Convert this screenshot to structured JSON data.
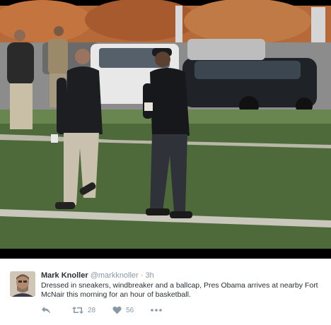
{
  "photo": {
    "description_icon": "photo-image"
  },
  "tweet": {
    "author_name": "Mark Knoller",
    "author_handle": "@markknoller",
    "separator": "·",
    "time": "3h",
    "text": "Dressed in sneakers, windbreaker and a ballcap, Pres Obama arrives at nearby Fort McNair this morning for an hour of basketball.",
    "actions": {
      "reply_icon": "reply-icon",
      "retweet_icon": "retweet-icon",
      "retweet_count": "28",
      "like_icon": "heart-icon",
      "like_count": "56",
      "more_icon": "more-dots-icon"
    }
  },
  "colors": {
    "name": "#292f33",
    "muted": "#8899a6",
    "grass": "#4f6a3a"
  }
}
